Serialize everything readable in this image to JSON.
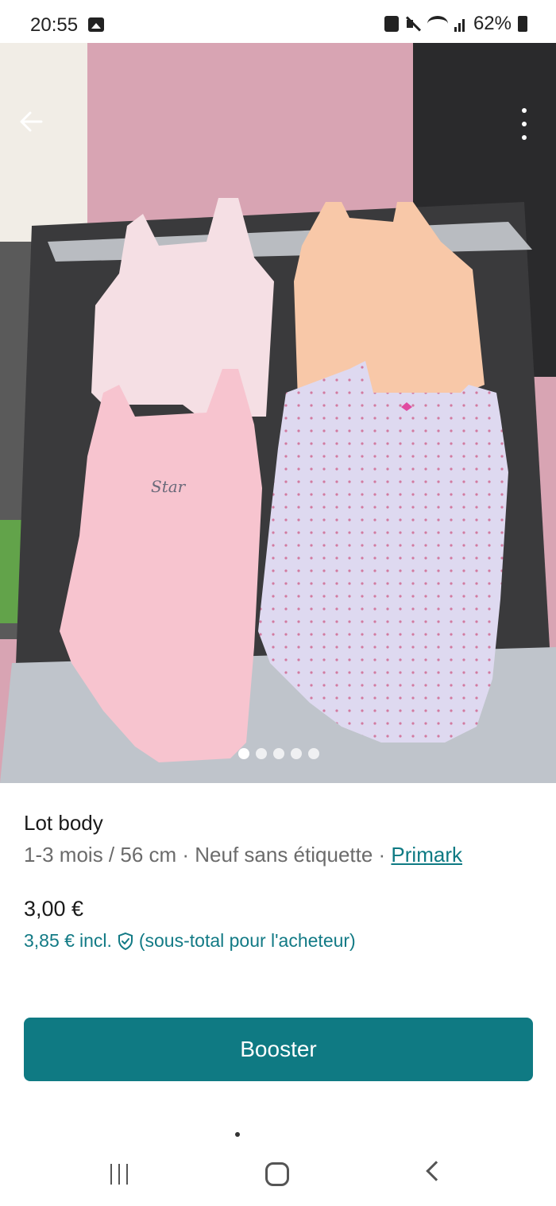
{
  "status_bar": {
    "time": "20:55",
    "battery": "62%"
  },
  "listing": {
    "title": "Lot body",
    "meta": "1-3 mois / 56 cm · Neuf sans étiquette · ",
    "brand": "Primark",
    "price": "3,00 €",
    "total_price": "3,85 €",
    "total_incl": "incl.",
    "total_note": "(sous-total pour l'acheteur)",
    "photo_count": 5,
    "active_photo": 1
  },
  "actions": {
    "booster_label": "Booster"
  },
  "icons": {
    "back": "arrow-left-icon",
    "more": "more-vertical-icon",
    "shield": "shield-check-icon"
  },
  "colors": {
    "accent": "#0f7a83",
    "link": "#127a85"
  }
}
